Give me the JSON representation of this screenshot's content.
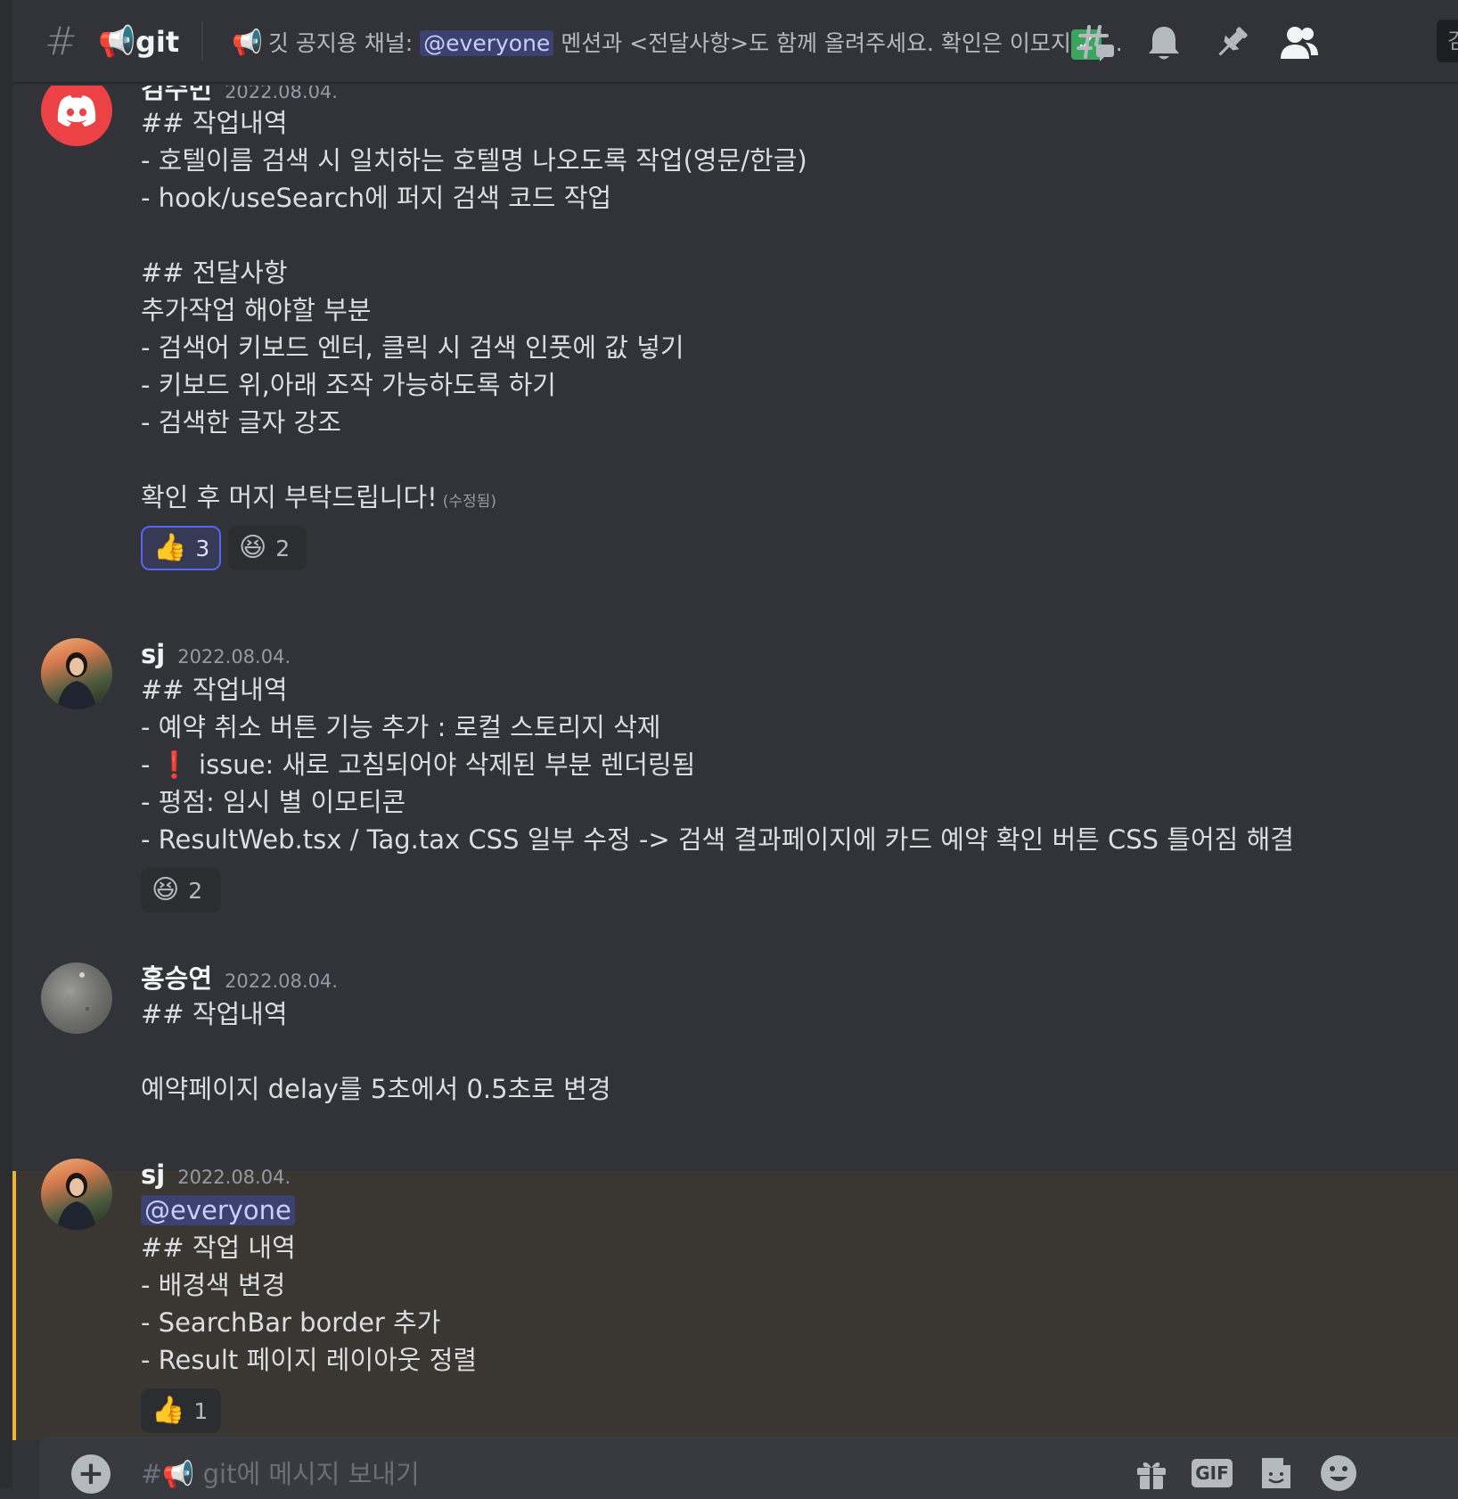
{
  "header": {
    "channel_emoji": "📢",
    "channel_name": "git",
    "topic_prefix_emoji": "📢",
    "topic_text_before": "깃 공지용 채널: ",
    "topic_mention": "@everyone",
    "topic_text_after": " 멘션과 <전달사항>도 함께 올려주세요. 확인은 이모지",
    "topic_check": "✓",
    "topic_ellipsis": "...",
    "search_label": "검"
  },
  "messages": [
    {
      "author": "김수빈",
      "timestamp": "2022.08.04.",
      "lines": [
        "## 작업내역",
        "- 호텔이름 검색 시 일치하는 호텔명 나오도록 작업(영문/한글)",
        "- hook/useSearch에 퍼지 검색 코드 작업",
        "",
        "## 전달사항",
        "추가작업 해야할 부분",
        "- 검색어 키보드 엔터, 클릭 시 검색 인풋에 값 넣기",
        "- 키보드 위,아래 조작 가능하도록 하기",
        "- 검색한 글자 강조",
        "",
        "확인 후 머지 부탁드립니다!"
      ],
      "edited_label": "(수정됨)",
      "reactions": [
        {
          "emoji": "👍",
          "count": "3",
          "active": true
        },
        {
          "emoji": "😆",
          "count": "2",
          "active": false
        }
      ]
    },
    {
      "author": "sj",
      "timestamp": "2022.08.04.",
      "lines": [
        "## 작업내역",
        "- 예약 취소 버튼 기능 추가 : 로컬 스토리지 삭제",
        "-  ❗  issue: 새로 고침되어야 삭제된 부분 렌더링됨",
        "- 평점: 임시 별 이모티콘",
        "- ResultWeb.tsx / Tag.tax CSS 일부 수정 -> 검색 결과페이지에 카드 예약 확인 버튼 CSS 틀어짐 해결"
      ],
      "reactions": [
        {
          "emoji": "😆",
          "count": "2",
          "active": false
        }
      ]
    },
    {
      "author": "홍승연",
      "timestamp": "2022.08.04.",
      "lines": [
        "## 작업내역",
        "",
        "예약페이지 delay를 5초에서 0.5초로 변경"
      ]
    },
    {
      "author": "sj",
      "timestamp": "2022.08.04.",
      "mention": "@everyone",
      "lines": [
        "## 작업 내역",
        "- 배경색 변경",
        "- SearchBar border 추가",
        "- Result 페이지 레이아웃 정렬"
      ],
      "reactions": [
        {
          "emoji": "👍",
          "count": "1",
          "active": false
        }
      ]
    }
  ],
  "composer": {
    "placeholder": "#📢 git에 메시지 보내기",
    "gif_label": "GIF"
  },
  "colors": {
    "background": "#313338",
    "mention_bg": "#3c4270",
    "highlight_bg": "#3a3632",
    "highlight_bar": "#f0b232",
    "reaction_active_border": "#5865f2",
    "discord_red": "#ed4245"
  }
}
